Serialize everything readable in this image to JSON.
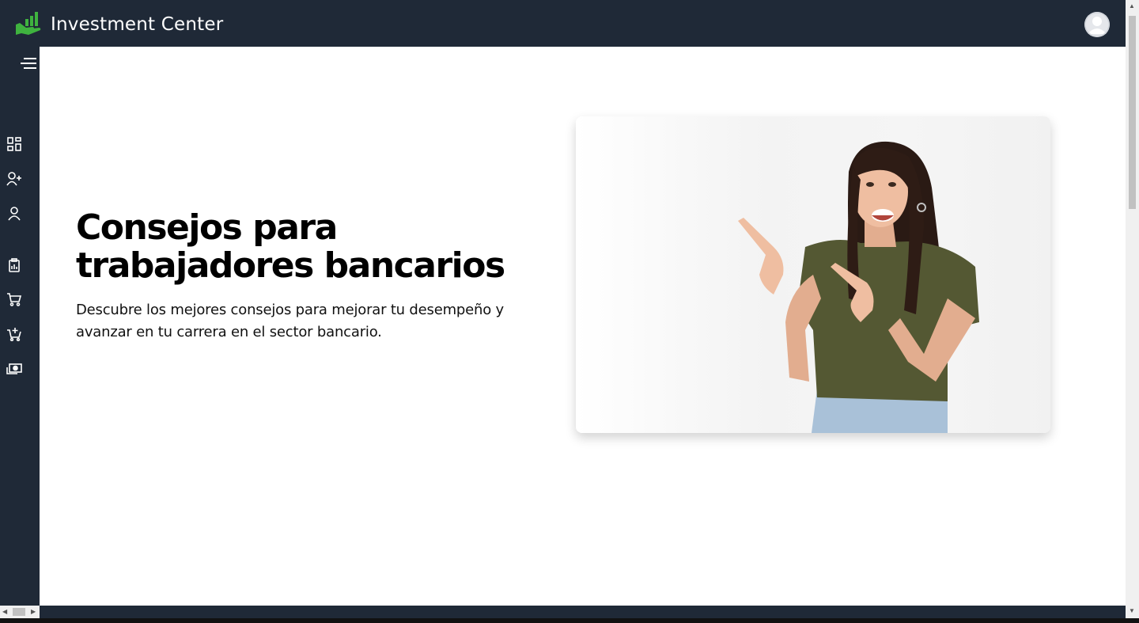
{
  "header": {
    "app_title": "Investment Center",
    "logo_icon": "hand-growth-chart-icon",
    "brand_color": "#3fb33f",
    "avatar_icon": "user-avatar-icon"
  },
  "sidebar": {
    "menu_icon": "hamburger-menu-icon",
    "items": [
      {
        "icon": "dashboard-icon"
      },
      {
        "icon": "add-user-icon"
      },
      {
        "icon": "user-icon"
      },
      {
        "icon": "report-clipboard-icon"
      },
      {
        "icon": "shopping-cart-icon"
      },
      {
        "icon": "add-to-cart-icon"
      },
      {
        "icon": "money-exchange-icon"
      }
    ]
  },
  "hero": {
    "title": "Consejos para trabajadores bancarios",
    "description": "Descubre los mejores consejos para mejorar tu desempeño y avanzar en tu carrera en el sector bancario.",
    "image_icon": "woman-pointing-photo"
  },
  "colors": {
    "topbar_bg": "#1f2937",
    "main_bg": "#ffffff"
  }
}
